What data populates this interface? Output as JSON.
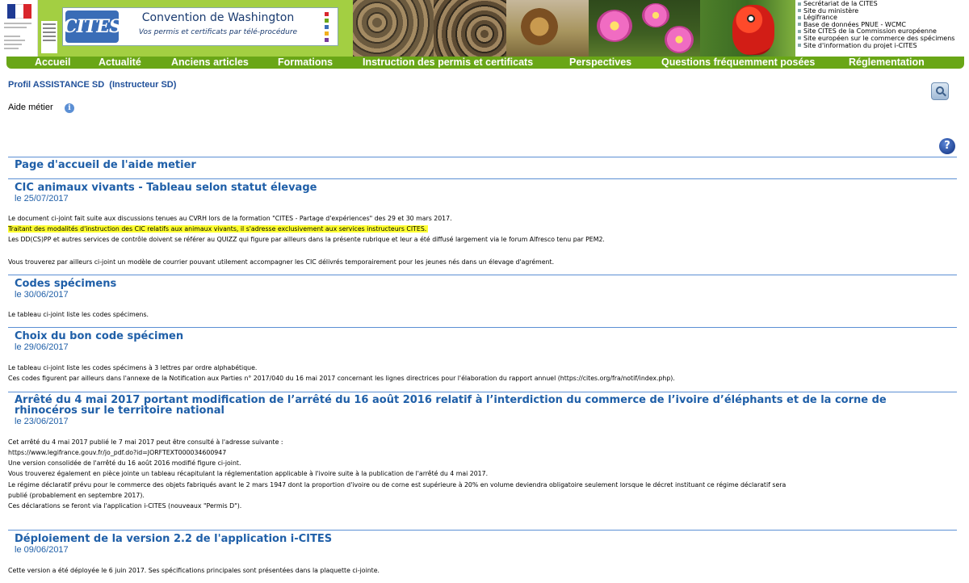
{
  "header": {
    "cites_title": "Convention de Washington",
    "cites_subtitle": "Vos permis et certificats par télé-procédure",
    "cites_logo_text": "CITES",
    "ext_links": [
      "Secrétariat de la CITES",
      "Site du ministère",
      "Légifrance",
      "Base de données PNUE - WCMC",
      "Site CITES de la Commission européenne",
      "Site européen sur le commerce des spécimens",
      "Site d'information du projet i-CITES"
    ]
  },
  "nav": {
    "items": [
      "Accueil",
      "Actualité",
      "Anciens articles",
      "Formations",
      "Instruction des permis et certificats",
      "Perspectives",
      "Questions fréquemment posées",
      "Réglementation"
    ]
  },
  "profile": {
    "label": "Profil ASSISTANCE SD  (Instructeur SD)",
    "aide_metier": "Aide métier"
  },
  "home_title": "Page d'accueil de l'aide metier",
  "sections": [
    {
      "title": "CIC animaux vivants - Tableau selon statut élevage",
      "date": "le 25/07/2017",
      "lines": [
        "Le document ci-joint fait suite aux discussions tenues au CVRH lors de la formation \"CITES - Partage d'expériences\" des 29 et 30 mars 2017.",
        "Traitant des modalités d'instruction des CIC relatifs aux animaux vivants, il s'adresse exclusivement aux services instructeurs CITES.",
        "Les DD(CS)PP et autres services de contrôle doivent se référer au QUIZZ qui figure par ailleurs dans la présente rubrique et leur a été diffusé largement via le forum Alfresco tenu par PEM2.",
        "Vous trouverez par ailleurs ci-joint un modèle de courrier pouvant utilement accompagner les CIC délivrés temporairement pour les jeunes nés dans un élevage d'agrément."
      ]
    },
    {
      "title": "Codes spécimens",
      "date": "le 30/06/2017",
      "lines": [
        "Le tableau ci-joint liste les codes spécimens."
      ]
    },
    {
      "title": "Choix du bon code spécimen",
      "date": "le 29/06/2017",
      "lines": [
        "Le tableau ci-joint liste les codes spécimens à 3 lettres par ordre alphabétique.",
        "Ces codes figurent par ailleurs dans l'annexe de la Notification aux Parties n° 2017/040 du 16 mai 2017 concernant les lignes directrices pour l'élaboration du rapport annuel (https://cites.org/fra/notif/index.php)."
      ]
    },
    {
      "title": "Arrêté du 4 mai 2017 portant modification de l’arrêté du 16 août 2016 relatif à l’interdiction du commerce de l’ivoire d’éléphants et de la corne de rhinocéros sur le territoire national",
      "date": "le 23/06/2017",
      "lines": [
        "Cet arrêté du 4 mai 2017 publié le 7 mai 2017 peut être consulté à l'adresse suivante :",
        "https://www.legifrance.gouv.fr/jo_pdf.do?id=JORFTEXT000034600947",
        "Une version consolidée de l'arrêté du 16 août 2016 modifié figure ci-joint.",
        "Vous trouverez également en pièce jointe un tableau récapitulant la réglementation applicable à l'ivoire suite à la publication de l'arrêté du 4 mai 2017.",
        "Le régime déclaratif prévu pour le commerce des objets fabriqués avant le 2 mars 1947 dont la proportion d'ivoire ou de corne est supérieure à 20% en volume deviendra obligatoire seulement lorsque le décret instituant ce régime déclaratif sera",
        "publié (probablement en septembre 2017).",
        "Ces déclarations se feront via l'application i-CITES (nouveaux \"Permis D\")."
      ]
    },
    {
      "title": "Déploiement de la version 2.2 de l'application i-CITES",
      "date": "le 09/06/2017",
      "lines": [
        "Cette version a été déployée le 6 juin 2017. Ses spécifications principales sont présentées dans la plaquette ci-jointe."
      ]
    }
  ]
}
